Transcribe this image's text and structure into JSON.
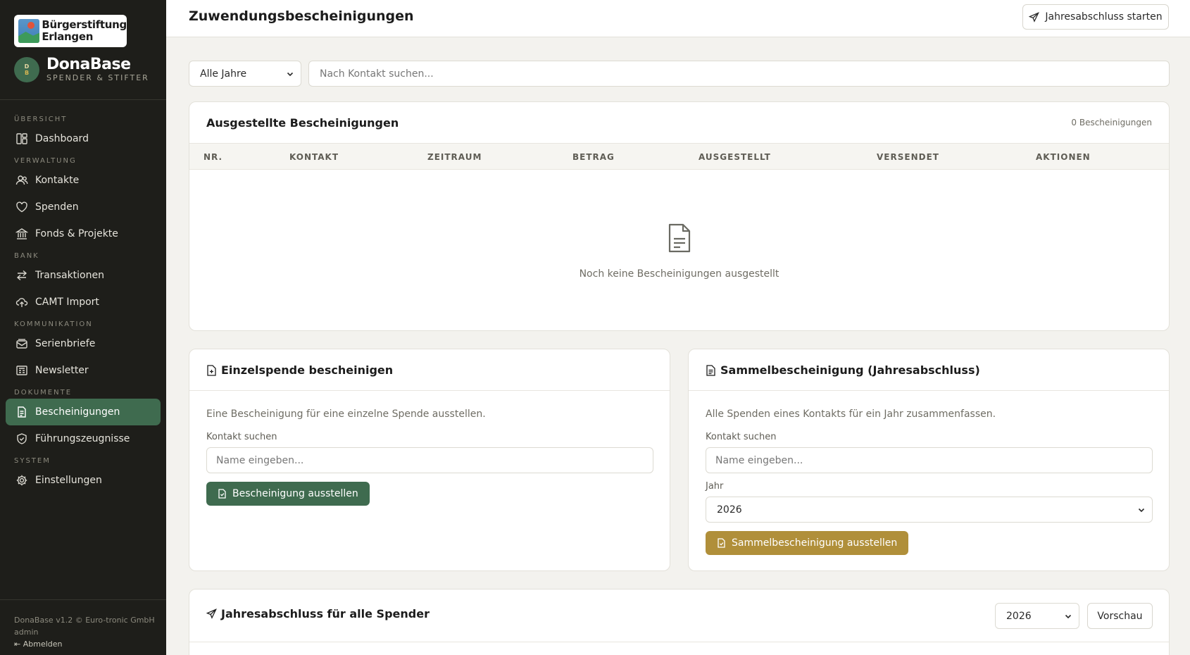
{
  "brand": {
    "logo_text_line1": "Bürgerstiftung",
    "logo_text_line2": "Erlangen",
    "avatar_line1": "D",
    "avatar_line2": "B",
    "app_name": "DonaBase",
    "app_tagline": "SPENDER & STIFTER"
  },
  "nav": {
    "sections": {
      "overview": "ÜBERSICHT",
      "admin": "VERWALTUNG",
      "bank": "BANK",
      "communication": "KOMMUNIKATION",
      "documents": "DOKUMENTE",
      "system": "SYSTEM"
    },
    "items": {
      "dashboard": "Dashboard",
      "contacts": "Kontakte",
      "donations": "Spenden",
      "funds": "Fonds & Projekte",
      "transactions": "Transaktionen",
      "camt": "CAMT Import",
      "letters": "Serienbriefe",
      "newsletter": "Newsletter",
      "certificates": "Bescheinigungen",
      "conduct": "Führungszeugnisse",
      "settings": "Einstellungen"
    }
  },
  "footer": {
    "version": "DonaBase v1.2 © Euro-tronic GmbH",
    "user": "admin",
    "logout": "Abmelden"
  },
  "header": {
    "title": "Zuwendungsbescheinigungen",
    "action_label": "Jahresabschluss starten"
  },
  "filters": {
    "year_selected": "Alle Jahre",
    "search_placeholder": "Nach Kontakt suchen..."
  },
  "issued": {
    "title": "Ausgestellte Bescheinigungen",
    "count": "0 Bescheinigungen",
    "columns": [
      "NR.",
      "KONTAKT",
      "ZEITRAUM",
      "BETRAG",
      "AUSGESTELLT",
      "VERSENDET",
      "AKTIONEN"
    ],
    "empty_text": "Noch keine Bescheinigungen ausgestellt"
  },
  "single": {
    "title": "Einzelspende bescheinigen",
    "description": "Eine Bescheinigung für eine einzelne Spende ausstellen.",
    "contact_label": "Kontakt suchen",
    "contact_placeholder": "Name eingeben...",
    "button": "Bescheinigung ausstellen"
  },
  "collective": {
    "title": "Sammelbescheinigung (Jahresabschluss)",
    "description": "Alle Spenden eines Kontakts für ein Jahr zusammenfassen.",
    "contact_label": "Kontakt suchen",
    "contact_placeholder": "Name eingeben...",
    "year_label": "Jahr",
    "year_selected": "2026",
    "button": "Sammelbescheinigung ausstellen"
  },
  "annual": {
    "title": "Jahresabschluss für alle Spender",
    "year_selected": "2026",
    "preview_button": "Vorschau"
  },
  "colors": {
    "sidebar_bg": "#1e1e1a",
    "accent_green": "#3f6b4f",
    "accent_gold": "#b08f3a",
    "page_bg": "#f3f2ee"
  }
}
